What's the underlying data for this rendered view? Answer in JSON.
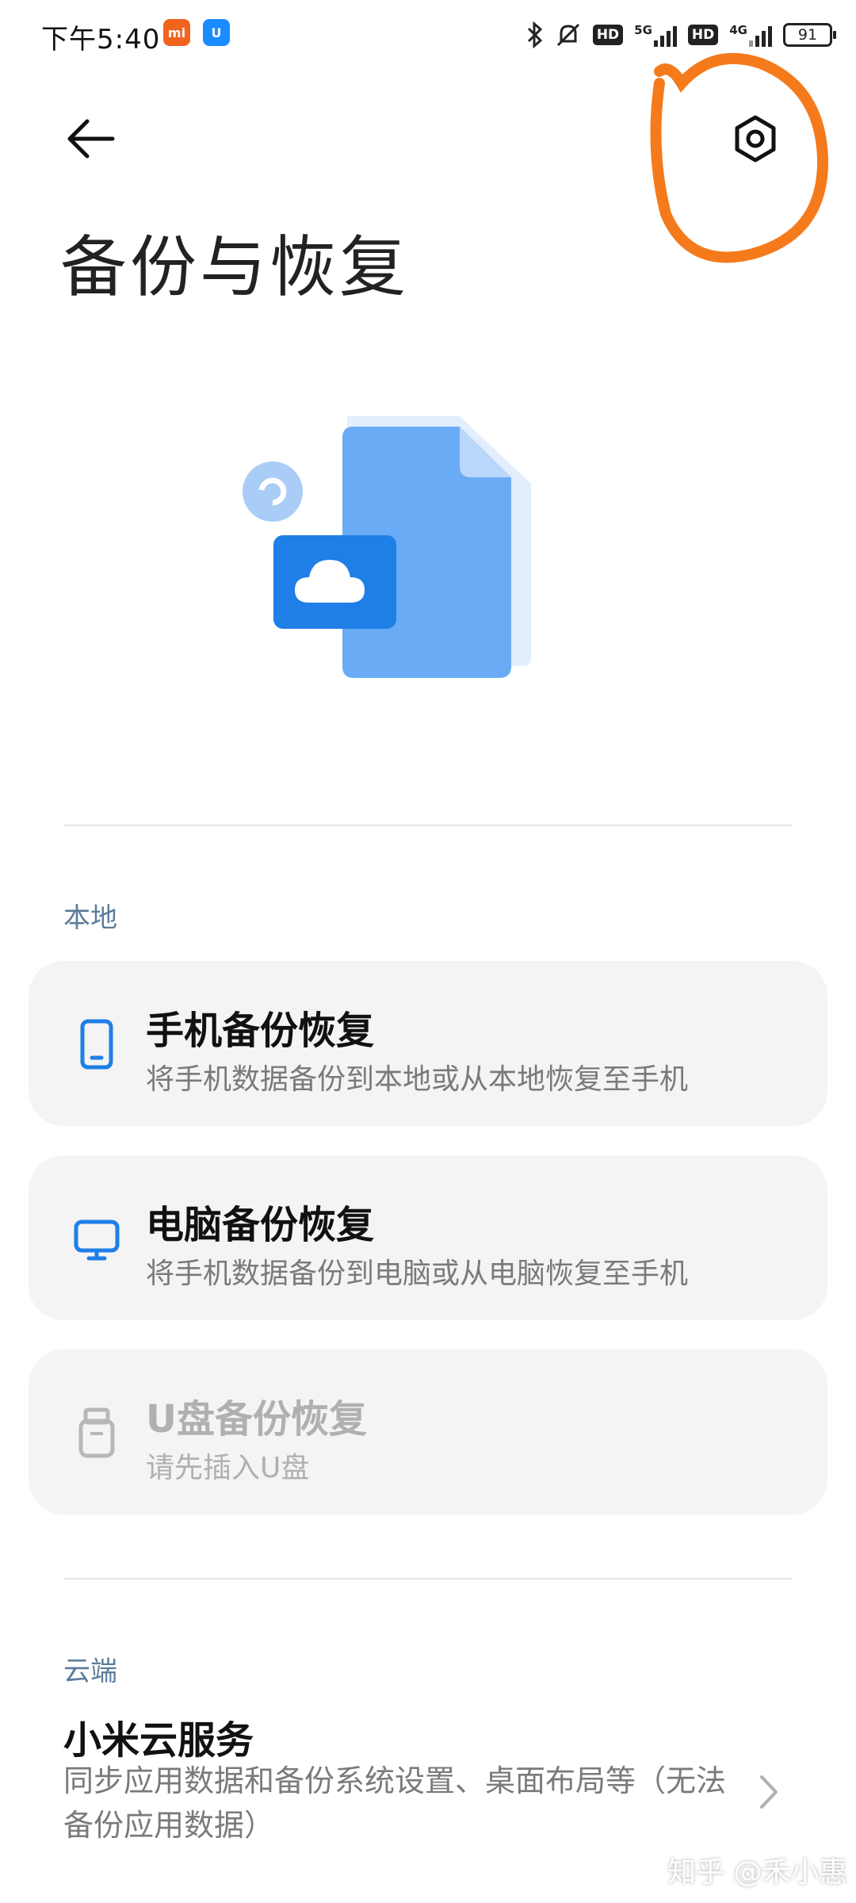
{
  "status_bar": {
    "time": "下午5:40",
    "network_5g": "5G",
    "network_4g": "4G",
    "hd_label": "HD",
    "battery": "91"
  },
  "header": {
    "title": "备份与恢复",
    "back_icon": "back-arrow-icon",
    "settings_icon": "hexagon-settings-icon"
  },
  "local": {
    "section_label": "本地",
    "items": [
      {
        "title": "手机备份恢复",
        "subtitle": "将手机数据备份到本地或从本地恢复至手机",
        "icon": "phone-icon",
        "enabled": true
      },
      {
        "title": "电脑备份恢复",
        "subtitle": "将手机数据备份到电脑或从电脑恢复至手机",
        "icon": "computer-icon",
        "enabled": true
      },
      {
        "title": "U盘备份恢复",
        "subtitle": "请先插入U盘",
        "icon": "usb-drive-icon",
        "enabled": false
      }
    ]
  },
  "cloud": {
    "section_label": "云端",
    "title": "小米云服务",
    "subtitle": "同步应用数据和备份系统设置、桌面布局等（无法备份应用数据）"
  },
  "watermark": "知乎 @禾小惠",
  "colors": {
    "accent": "#1e7fe6",
    "annotation": "#f57a1c",
    "section_label": "#5c7c9c"
  }
}
